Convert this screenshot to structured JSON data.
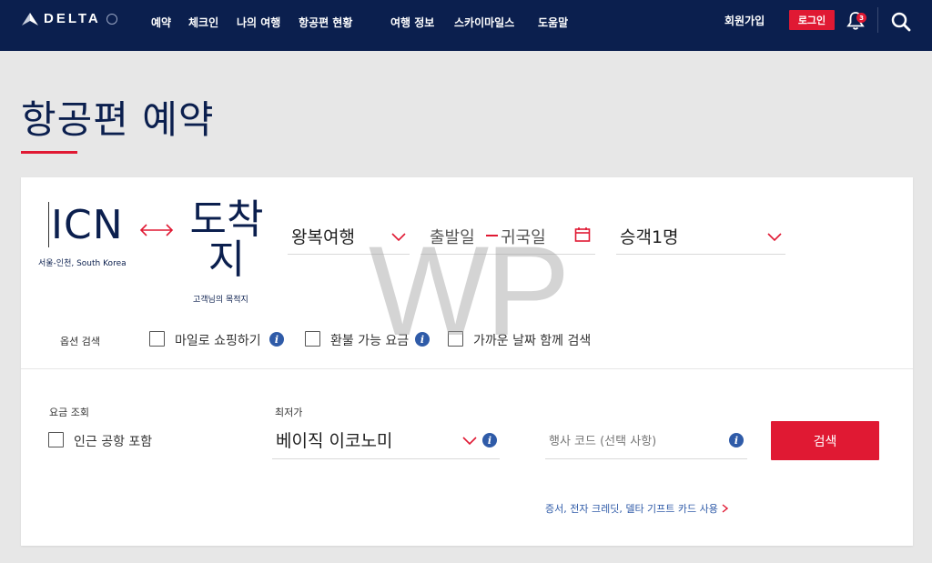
{
  "header": {
    "brand": "DELTA",
    "nav": [
      "예약",
      "체크인",
      "나의 여행",
      "항공편 현황",
      "여행 정보",
      "스카이마일스",
      "도움말"
    ],
    "signup": "회원가입",
    "login": "로그인",
    "notification_count": "3"
  },
  "page": {
    "title": "항공편 예약"
  },
  "booking": {
    "origin_code": "ICN",
    "origin_city": "서울-인천, South Korea",
    "destination_code": "도착지",
    "destination_sub": "고객님의 목적지",
    "trip_type": "왕복여행",
    "depart_label": "출발일",
    "return_label": "귀국일",
    "passengers": "승객1명",
    "options_label": "옵션 검색",
    "opt_miles": "마일로 쇼핑하기",
    "opt_refundable": "환불 가능 요금",
    "opt_flexible": "가까운 날짜 함께 검색",
    "fare_label": "요금 조회",
    "nearby_airports": "인근 공항 포함",
    "lowest_label": "최저가",
    "cabin": "베이직 이코노미",
    "agency_placeholder": "행사 코드 (선택 사항)",
    "search_button": "검색",
    "voucher_link": "증서, 전자 크레딧, 델타 기프트 카드 사용"
  },
  "watermark": "WP",
  "colors": {
    "navy": "#0b1f4e",
    "red": "#e01933",
    "link_blue": "#2f5ba8"
  }
}
